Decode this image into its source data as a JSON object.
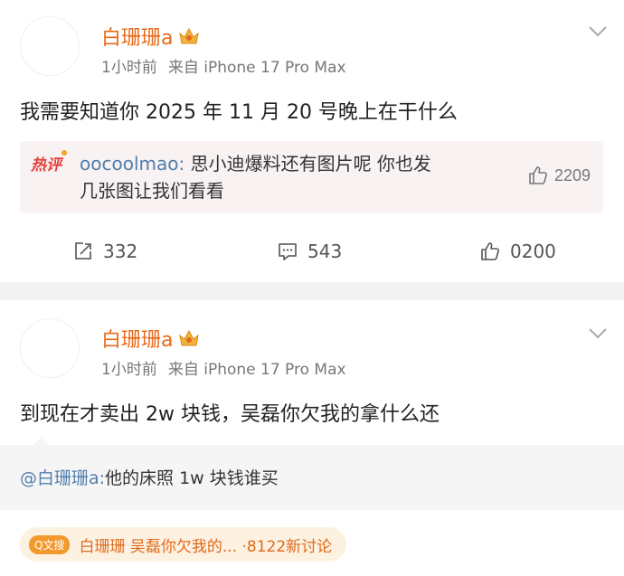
{
  "post1": {
    "username": "白珊珊a",
    "time": "1小时前",
    "source": "来自 iPhone 17 Pro Max",
    "text": "我需要知道你 2025 年 11 月 20 号晚上在干什么",
    "hot_comment": {
      "badge": "热评",
      "commenter": "oocoolmao:",
      "line1": " 思小迪爆料还有图片呢 你也发",
      "line2": "几张图让我们看看",
      "likes": "2209"
    },
    "actions": {
      "reposts": "332",
      "comments": "543",
      "likes": "0200"
    }
  },
  "post2": {
    "username": "白珊珊a",
    "time": "1小时前",
    "source": "来自 iPhone 17 Pro Max",
    "text": "到现在才卖出 2w 块钱，吴磊你欠我的拿什么还",
    "quote": {
      "mention": "@白珊珊a:",
      "text": "他的床照 1w 块钱谁买"
    },
    "topic": {
      "badge": "Q文搜",
      "text": "白珊珊 吴磊你欠我的... ·8122新讨论"
    }
  },
  "colors": {
    "username": "#e86a1c",
    "link": "#507daf",
    "hot_red": "#e4403c",
    "separator": "#f2f2f2"
  }
}
